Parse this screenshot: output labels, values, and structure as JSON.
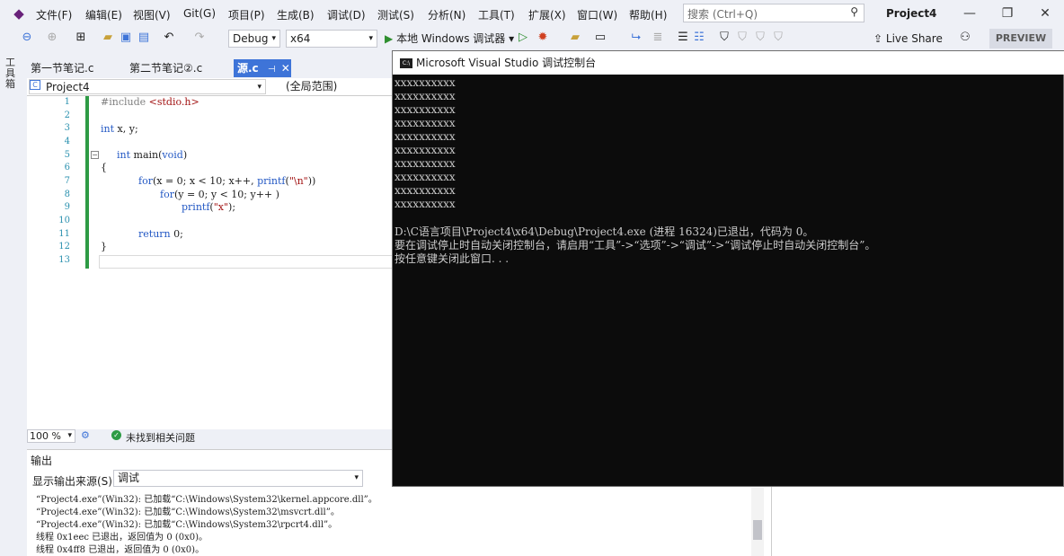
{
  "menu": [
    "文件(F)",
    "编辑(E)",
    "视图(V)",
    "Git(G)",
    "项目(P)",
    "生成(B)",
    "调试(D)",
    "测试(S)",
    "分析(N)",
    "工具(T)",
    "扩展(X)",
    "窗口(W)",
    "帮助(H)"
  ],
  "search": {
    "placeholder": "搜索 (Ctrl+Q)"
  },
  "window": {
    "project": "Project4"
  },
  "toolbar": {
    "config": "Debug",
    "platform": "x64",
    "run_label": "本地 Windows 调试器",
    "live_share": "Live Share",
    "preview": "PREVIEW"
  },
  "toolbox_label": "工具箱",
  "tabs": [
    "第一节笔记.c",
    "第二节笔记②.c",
    "源.c"
  ],
  "nav": {
    "project": "Project4",
    "scope": "(全局范围)"
  },
  "editor": {
    "line_numbers": [
      "1",
      "2",
      "3",
      "4",
      "5",
      "6",
      "7",
      "8",
      "9",
      "10",
      "11",
      "12",
      "13"
    ],
    "lines": {
      "l1_pp": "#include ",
      "l1_inc": "<stdio.h>",
      "l3_kw": "int",
      "l3_rest": " x, y;",
      "l5_kw": "int",
      "l5_rest": " main(",
      "l5_void": "void",
      "l5_end": ")",
      "l6": "{",
      "l7_for": "for",
      "l7_a": "(x = 0; x < 10; x++, ",
      "l7_fn": "printf",
      "l7_b": "(",
      "l7_str": "\"\\n\"",
      "l7_c": "))",
      "l8_for": "for",
      "l8_a": "(y = 0; y < 10; y++ )",
      "l9_fn": "printf",
      "l9_a": "(",
      "l9_str": "\"x\"",
      "l9_b": ");",
      "l11_ret": "return",
      "l11_a": " 0;",
      "l12": "}"
    }
  },
  "status": {
    "zoom": "100 %",
    "issues": "未找到相关问题"
  },
  "output": {
    "title": "输出",
    "source_label": "显示输出来源(S):",
    "source_value": "调试",
    "lines": [
      "“Project4.exe”(Win32): 已加载“C:\\Windows\\System32\\kernel.appcore.dll”。",
      "“Project4.exe”(Win32): 已加载“C:\\Windows\\System32\\msvcrt.dll”。",
      "“Project4.exe”(Win32): 已加载“C:\\Windows\\System32\\rpcrt4.dll”。",
      "线程 0x1eec 已退出，返回值为 0 (0x0)。",
      "线程 0x4ff8 已退出，返回值为 0 (0x0)。"
    ]
  },
  "console": {
    "title": "Microsoft Visual Studio 调试控制台",
    "icon_text": "C:\\",
    "lines": [
      "xxxxxxxxxx",
      "xxxxxxxxxx",
      "xxxxxxxxxx",
      "xxxxxxxxxx",
      "xxxxxxxxxx",
      "xxxxxxxxxx",
      "xxxxxxxxxx",
      "xxxxxxxxxx",
      "xxxxxxxxxx",
      "xxxxxxxxxx",
      "",
      "D:\\C语言项目\\Project4\\x64\\Debug\\Project4.exe (进程 16324)已退出，代码为 0。",
      "要在调试停止时自动关闭控制台，请启用“工具”->“选项”->“调试”->“调试停止时自动关闭控制台”。",
      "按任意键关闭此窗口. . ."
    ]
  }
}
